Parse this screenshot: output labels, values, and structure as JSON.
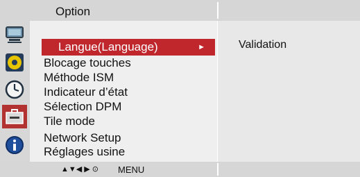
{
  "header": {
    "title": "Option"
  },
  "icons": [
    "monitor-icon",
    "audio-disc-icon",
    "clock-icon",
    "toolbox-icon",
    "info-icon"
  ],
  "menu": {
    "items": [
      {
        "label": "Langue(Language)",
        "selected": true
      },
      {
        "label": "Blocage touches"
      },
      {
        "label": "Méthode ISM"
      },
      {
        "label": "Indicateur d’état"
      },
      {
        "label": "Sélection DPM"
      },
      {
        "label": "Tile mode"
      },
      {
        "label": "Network Setup"
      },
      {
        "label": "Réglages usine"
      }
    ],
    "selected_arrow": "►"
  },
  "submenu": {
    "text": "Validation"
  },
  "footer": {
    "nav_symbols": "▲▼◀ ▶ ⊙",
    "menu_label": "MENU"
  },
  "colors": {
    "highlight": "#c0272d",
    "active_icon_bg": "#b23232"
  }
}
